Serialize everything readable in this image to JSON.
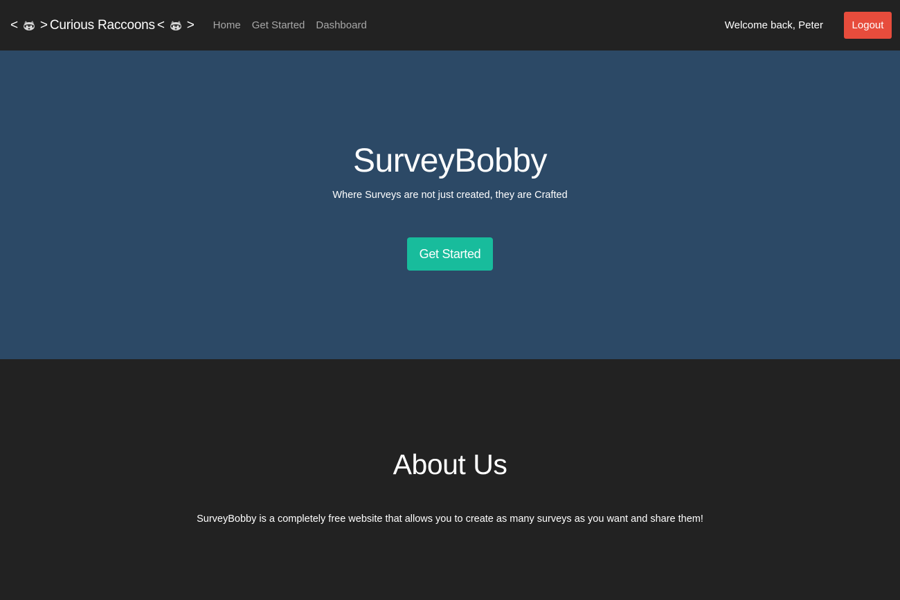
{
  "navbar": {
    "brand": {
      "prefix": "<",
      "arrow_left": ">",
      "name": "Curious Raccoons",
      "arrow_right_open": "<",
      "suffix": ">",
      "icon": "raccoon-icon"
    },
    "links": [
      {
        "label": "Home"
      },
      {
        "label": "Get Started"
      },
      {
        "label": "Dashboard"
      }
    ],
    "welcome_text": "Welcome back, Peter",
    "logout_label": "Logout",
    "colors": {
      "background": "#222222",
      "link": "#a7a7a7",
      "logout": "#e74c3c"
    }
  },
  "hero": {
    "title": "SurveyBobby",
    "subtitle": "Where Surveys are not just created, they are Crafted",
    "cta_label": "Get Started",
    "colors": {
      "background": "#2c4966",
      "cta": "#18bc9c"
    }
  },
  "about": {
    "title": "About Us",
    "text": "SurveyBobby is a completely free website that allows you to create as many surveys as you want and share them!"
  }
}
